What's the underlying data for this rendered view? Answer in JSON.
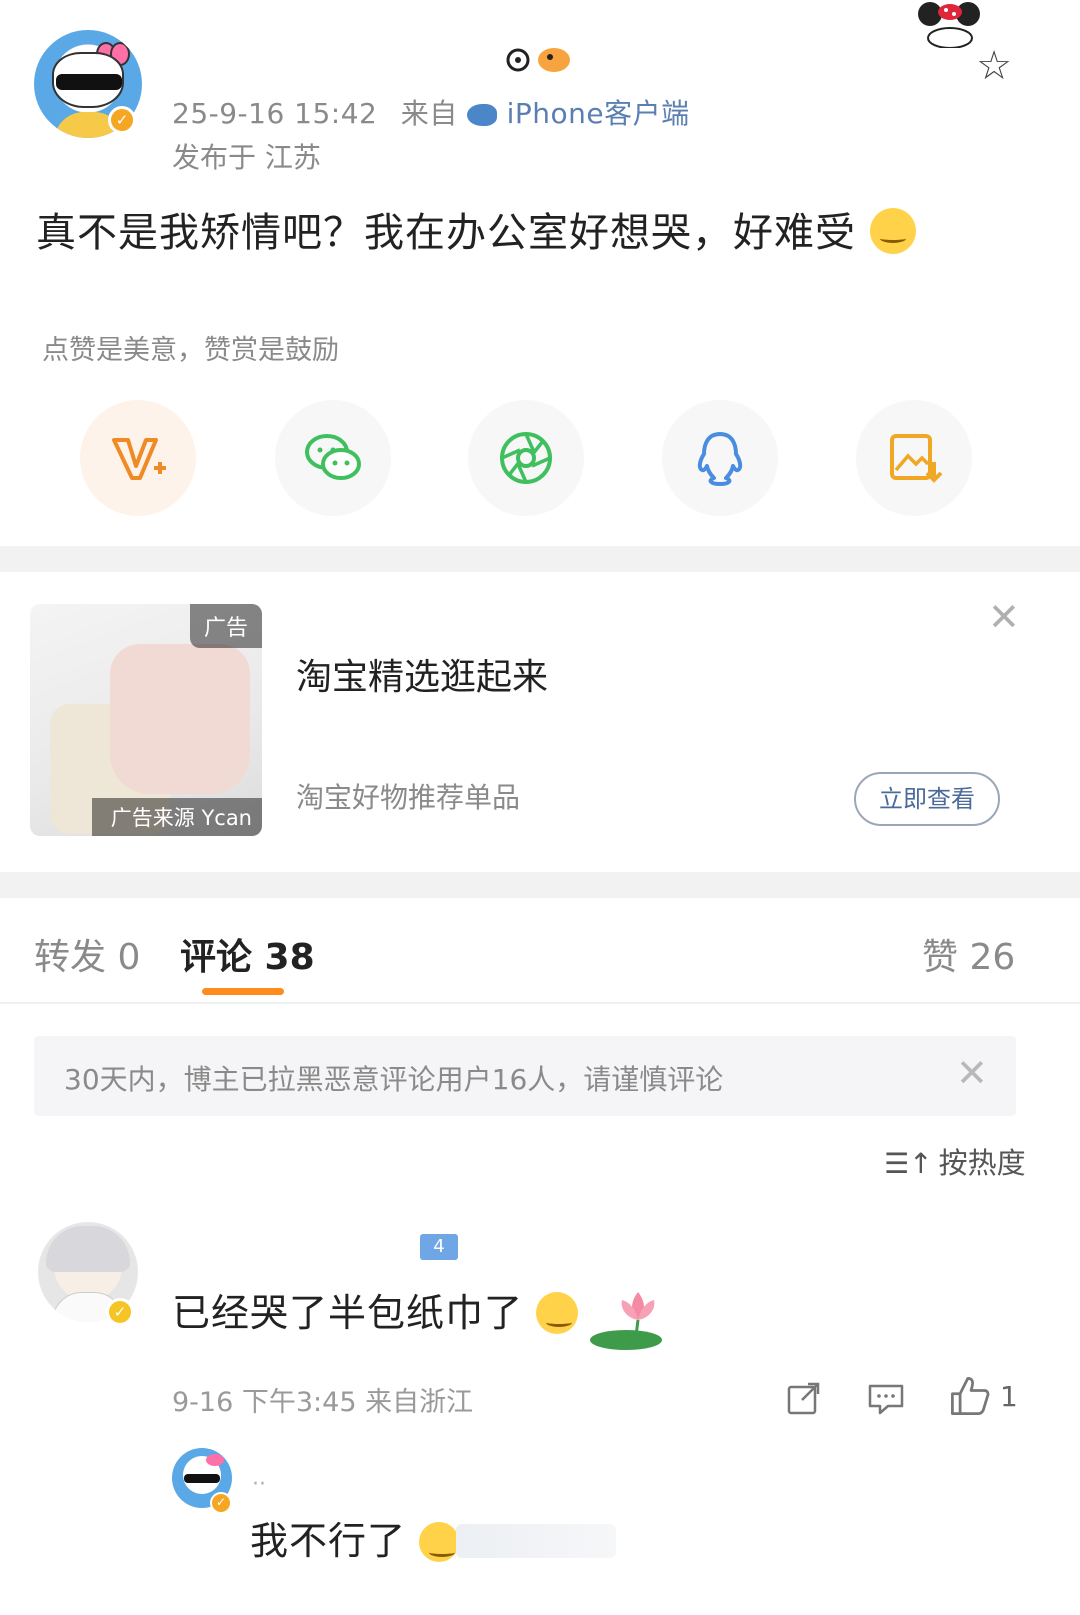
{
  "post": {
    "time": "25-9-16 15:42",
    "source_prefix": "来自",
    "source": "iPhone客户端",
    "location": "发布于 江苏",
    "text": "真不是我矫情吧？我在办公室好想哭，好难受"
  },
  "reward_hint": "点赞是美意，赞赏是鼓励",
  "share_icons": [
    "vplus-icon",
    "wechat-icon",
    "moments-icon",
    "qq-icon",
    "save-image-icon"
  ],
  "ad": {
    "tag": "广告",
    "source": "广告来源 Ycan",
    "title": "淘宝精选逛起来",
    "subtitle": "淘宝好物推荐单品",
    "cta": "立即查看"
  },
  "tabs": {
    "repost": "转发 0",
    "comment": "评论 38",
    "like": "赞 26"
  },
  "notice": "30天内，博主已拉黑恶意评论用户16人，请谨慎评论",
  "sort_label": "按热度",
  "comment": {
    "badge": "4",
    "text": "已经哭了半包纸巾了",
    "meta": "9-16 下午3:45 来自浙江",
    "likes": "1"
  },
  "reply": {
    "name": "··",
    "text": "我不行了"
  },
  "colors": {
    "accent": "#ff8a1d",
    "wechat": "#3fbf5e",
    "qq": "#4a8de0",
    "vplus": "#f08a24",
    "link": "#5b7fb0"
  }
}
